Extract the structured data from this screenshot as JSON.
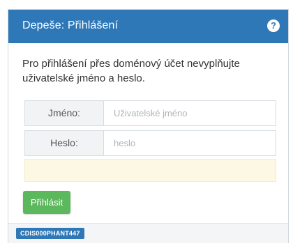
{
  "header": {
    "title": "Depeše: Přihlášení",
    "help_icon": "question-circle-icon"
  },
  "info_text": "Pro přihlášení přes doménový účet nevyplňujte uživatelské jméno a heslo.",
  "form": {
    "username": {
      "label": "Jméno:",
      "placeholder": "Uživatelské jméno",
      "value": ""
    },
    "password": {
      "label": "Heslo:",
      "placeholder": "heslo",
      "value": ""
    },
    "submit_label": "Přihlásit"
  },
  "footer": {
    "badge": "CDIS000PHANT447"
  },
  "colors": {
    "header": "#2f78b7",
    "button": "#5cb85c",
    "alert": "#fcf8e3"
  }
}
